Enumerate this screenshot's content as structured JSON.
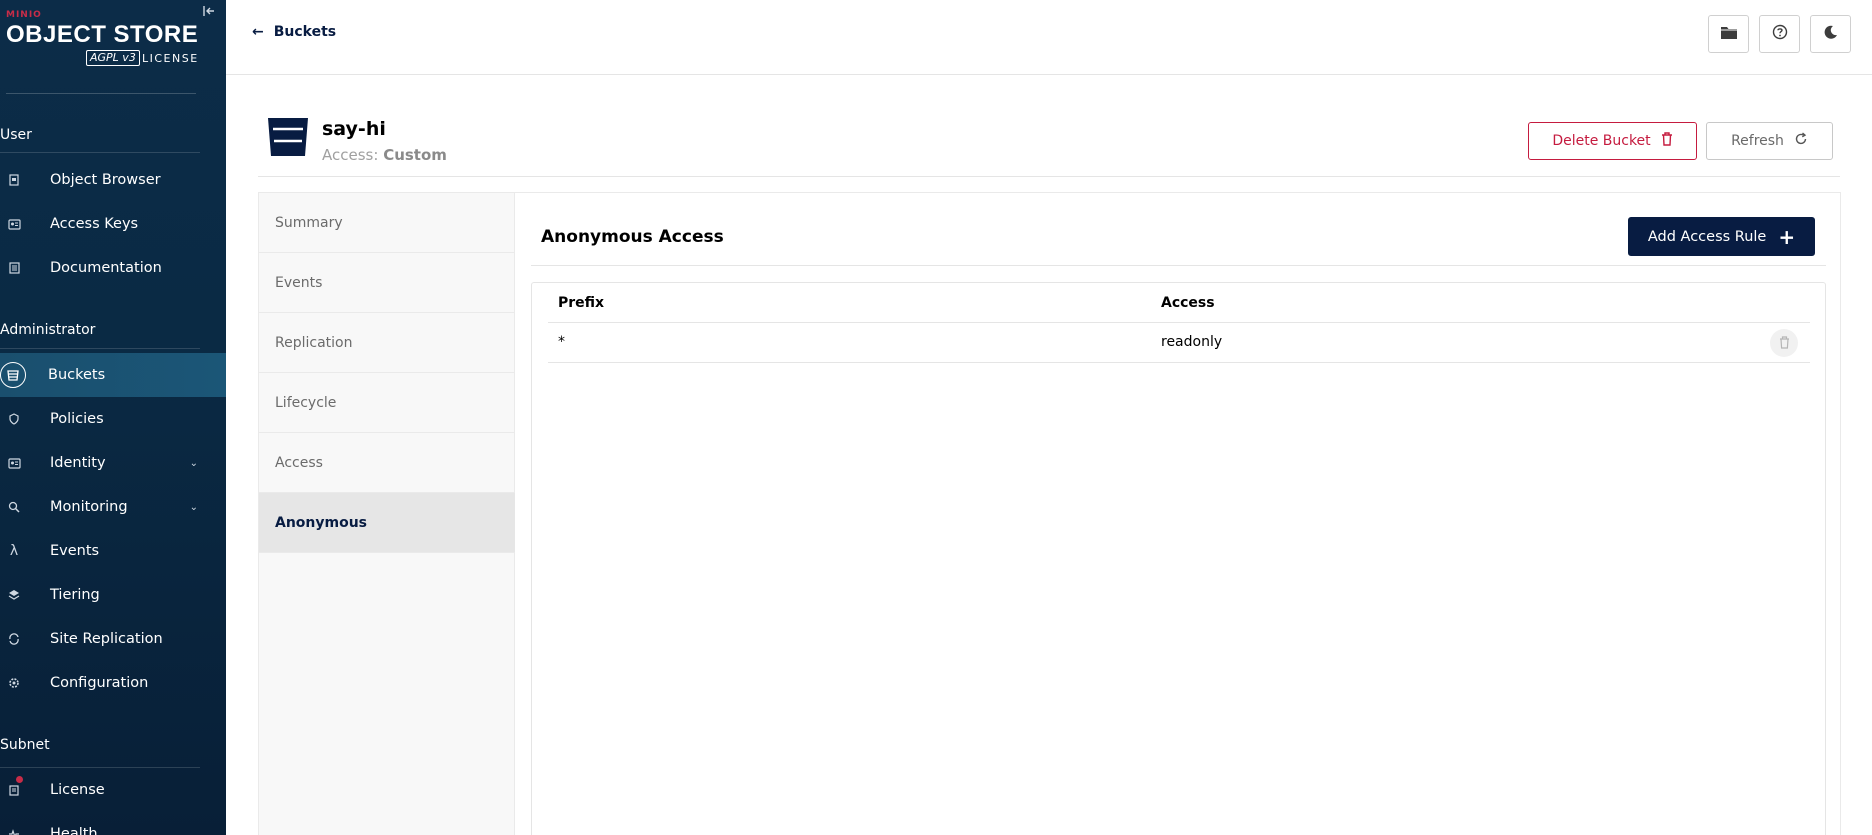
{
  "sidebar": {
    "logo": {
      "brand": "MINIO",
      "product": "OBJECT STORE",
      "badge": "AGPL v3",
      "license": "LICENSE"
    },
    "sections": {
      "user": "User",
      "administrator": "Administrator",
      "subnet": "Subnet"
    },
    "items": [
      {
        "label": "Object Browser",
        "icon": "object-browser-icon"
      },
      {
        "label": "Access Keys",
        "icon": "access-keys-icon"
      },
      {
        "label": "Documentation",
        "icon": "documentation-icon"
      },
      {
        "label": "Buckets",
        "icon": "buckets-icon",
        "active": true
      },
      {
        "label": "Policies",
        "icon": "policies-icon"
      },
      {
        "label": "Identity",
        "icon": "identity-icon",
        "expandable": true
      },
      {
        "label": "Monitoring",
        "icon": "monitoring-icon",
        "expandable": true
      },
      {
        "label": "Events",
        "icon": "lambda-icon"
      },
      {
        "label": "Tiering",
        "icon": "tiering-icon"
      },
      {
        "label": "Site Replication",
        "icon": "site-replication-icon"
      },
      {
        "label": "Configuration",
        "icon": "gear-icon"
      },
      {
        "label": "License",
        "icon": "license-icon"
      },
      {
        "label": "Health",
        "icon": "health-icon"
      }
    ]
  },
  "topbar": {
    "back_label": "Buckets"
  },
  "bucket": {
    "name": "say-hi",
    "access_label": "Access:",
    "access_value": "Custom",
    "delete_label": "Delete Bucket",
    "refresh_label": "Refresh"
  },
  "tabs": [
    "Summary",
    "Events",
    "Replication",
    "Lifecycle",
    "Access",
    "Anonymous"
  ],
  "active_tab": "Anonymous",
  "anonymous": {
    "title": "Anonymous Access",
    "add_label": "Add Access Rule",
    "columns": [
      "Prefix",
      "Access"
    ],
    "rows": [
      {
        "prefix": "*",
        "access": "readonly"
      }
    ]
  },
  "colors": {
    "sidebar_bg": "#0c2c48",
    "accent_navy": "#081c42",
    "danger": "#c51b3f",
    "brand_red": "#c72c48"
  }
}
